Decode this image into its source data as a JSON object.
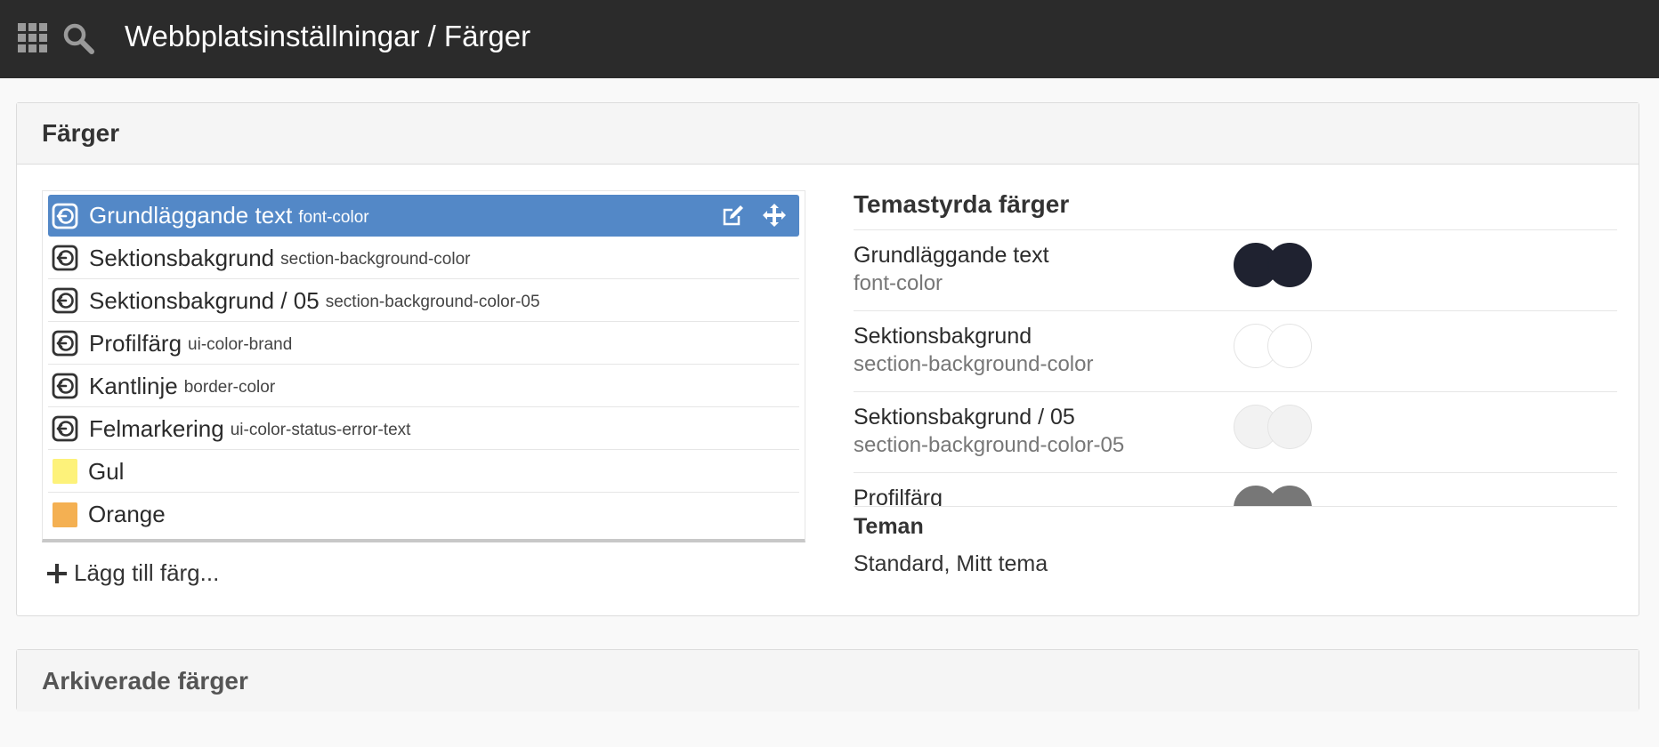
{
  "header": {
    "title": "Webbplatsinställningar / Färger",
    "icons": [
      "apps-grid-icon",
      "search-icon"
    ]
  },
  "colors_panel": {
    "title": "Färger",
    "items": [
      {
        "label": "Grundläggande text",
        "key": "font-color",
        "type": "theme",
        "selected": true
      },
      {
        "label": "Sektionsbakgrund",
        "key": "section-background-color",
        "type": "theme"
      },
      {
        "label": "Sektionsbakgrund / 05",
        "key": "section-background-color-05",
        "type": "theme"
      },
      {
        "label": "Profilfärg",
        "key": "ui-color-brand",
        "type": "theme"
      },
      {
        "label": "Kantlinje",
        "key": "border-color",
        "type": "theme"
      },
      {
        "label": "Felmarkering",
        "key": "ui-color-status-error-text",
        "type": "theme"
      },
      {
        "label": "Gul",
        "key": "",
        "type": "swatch",
        "color": "#fdf27a"
      },
      {
        "label": "Orange",
        "key": "",
        "type": "swatch",
        "color": "#f4b052"
      }
    ],
    "add_label": "Lägg till färg..."
  },
  "theme_colors": {
    "title": "Temastyrda färger",
    "items": [
      {
        "name": "Grundläggande text",
        "key": "font-color",
        "colors": [
          "#1f2230",
          "#1f2230"
        ]
      },
      {
        "name": "Sektionsbakgrund",
        "key": "section-background-color",
        "colors": [
          "#ffffff",
          "#ffffff"
        ]
      },
      {
        "name": "Sektionsbakgrund / 05",
        "key": "section-background-color-05",
        "colors": [
          "#f2f2f2",
          "#f2f2f2"
        ]
      },
      {
        "name": "Profilfärg",
        "key": "",
        "colors": [
          "#777777",
          "#777777"
        ]
      }
    ],
    "themes_label": "Teman",
    "themes_value": "Standard, Mitt tema"
  },
  "archived_panel": {
    "title": "Arkiverade färger"
  },
  "accent_color": "#5388c7"
}
